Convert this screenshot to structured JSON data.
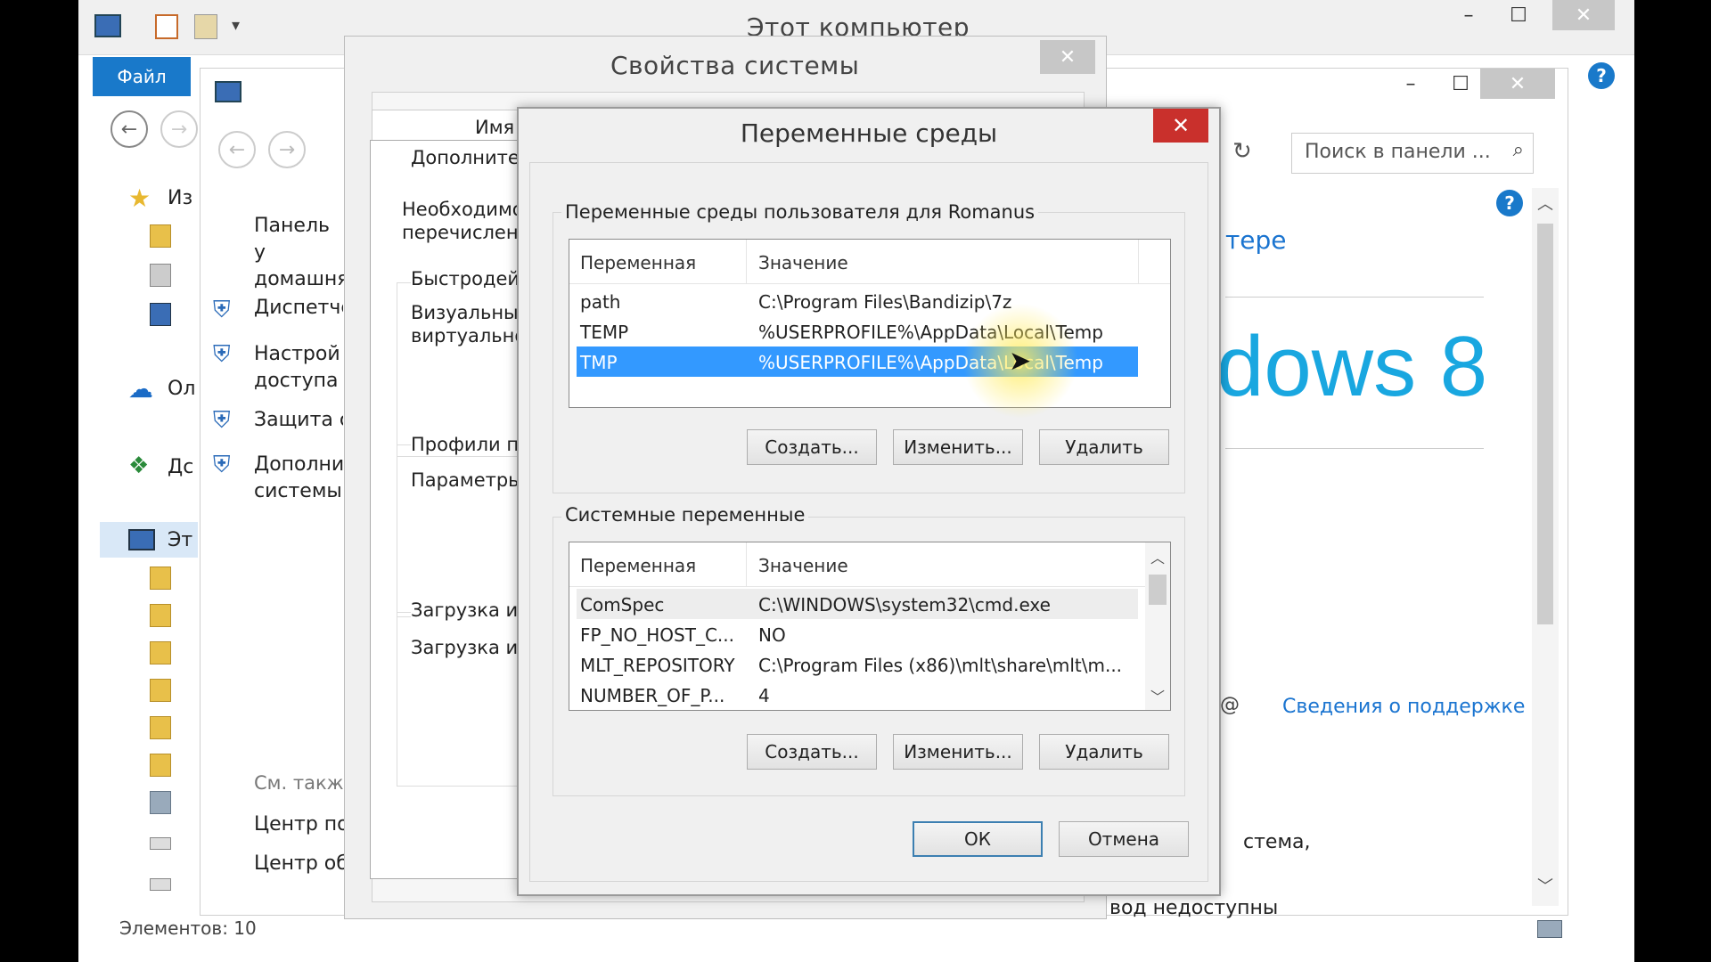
{
  "explorer": {
    "title": "Этот компьютер",
    "file_tab": "Файл",
    "nav_items": [
      "Из",
      "Ол",
      "Дс",
      "Эт"
    ],
    "status": "Элементов: 10"
  },
  "control_panel": {
    "search_placeholder": "Поиск в панели ...",
    "left_items": [
      "Панель у домашня",
      "Диспетче",
      "Настрой доступа",
      "Защита с",
      "Дополни системы"
    ],
    "see_also": "См. такж",
    "see_also_items": [
      "Центр по",
      "Центр об"
    ],
    "heading_fragment": "тере",
    "windows_logo": "dows 8",
    "support_link": "Сведения о поддержке",
    "text_fragment_1": "стема,",
    "text_fragment_2": "вод недоступны"
  },
  "system_properties": {
    "title": "Свойства системы",
    "col_fragment": "Имя",
    "tab_fragment": "Дополнител",
    "texts": [
      "Необходимо",
      "перечислен",
      "Быстродей",
      "Визуальны",
      "виртуально",
      "Профили по",
      "Параметры",
      "Загрузка и",
      "Загрузка и"
    ]
  },
  "env_dialog": {
    "title": "Переменные среды",
    "user_group_label": "Переменные среды пользователя для Romanus",
    "system_group_label": "Системные переменные",
    "col_var": "Переменная",
    "col_val": "Значение",
    "user_vars": [
      {
        "name": "path",
        "value": "C:\\Program Files\\Bandizip\\7z"
      },
      {
        "name": "TEMP",
        "value": "%USERPROFILE%\\AppData\\Local\\Temp"
      },
      {
        "name": "TMP",
        "value": "%USERPROFILE%\\AppData\\Local\\Temp"
      }
    ],
    "system_vars": [
      {
        "name": "ComSpec",
        "value": "C:\\WINDOWS\\system32\\cmd.exe"
      },
      {
        "name": "FP_NO_HOST_C...",
        "value": "NO"
      },
      {
        "name": "MLT_REPOSITORY",
        "value": "C:\\Program Files (x86)\\mlt\\share\\mlt\\m..."
      },
      {
        "name": "NUMBER_OF_P...",
        "value": "4"
      }
    ],
    "buttons": {
      "new": "Создать...",
      "edit": "Изменить...",
      "delete": "Удалить",
      "ok": "ОК",
      "cancel": "Отмена"
    }
  },
  "colors": {
    "selection": "#3399ff",
    "close_red": "#c9302c",
    "accent_blue": "#1979ca",
    "windows_logo": "#19a7e0"
  }
}
